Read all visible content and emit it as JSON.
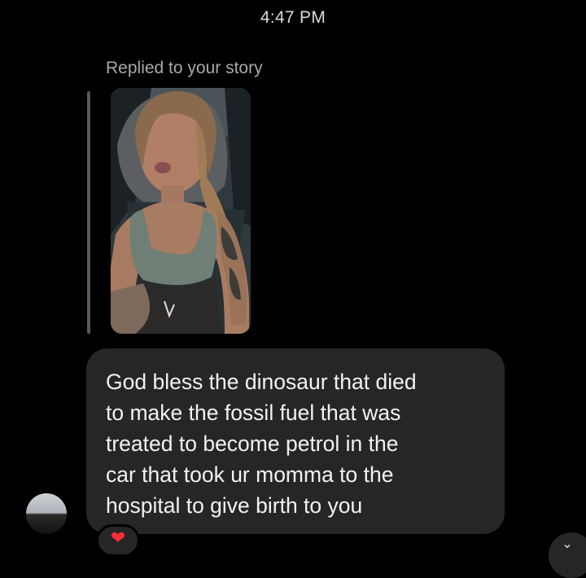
{
  "thread": {
    "timestamp": "4:47 PM",
    "reply_label": "Replied to your story"
  },
  "message": {
    "text": "God bless the dinosaur that died\nto make the fossil fuel that was\ntreated to become petrol in the\ncar that took ur momma to the\nhospital to give birth to you"
  },
  "reaction": {
    "icon": "heart-icon",
    "glyph": "❤"
  },
  "corner_button": {
    "icon": "chevron-down-icon",
    "glyph": "⌄"
  },
  "colors": {
    "background": "#000000",
    "bubble": "#262626",
    "reply_bar": "#5a5a5a",
    "heart": "#ff2d3b"
  }
}
